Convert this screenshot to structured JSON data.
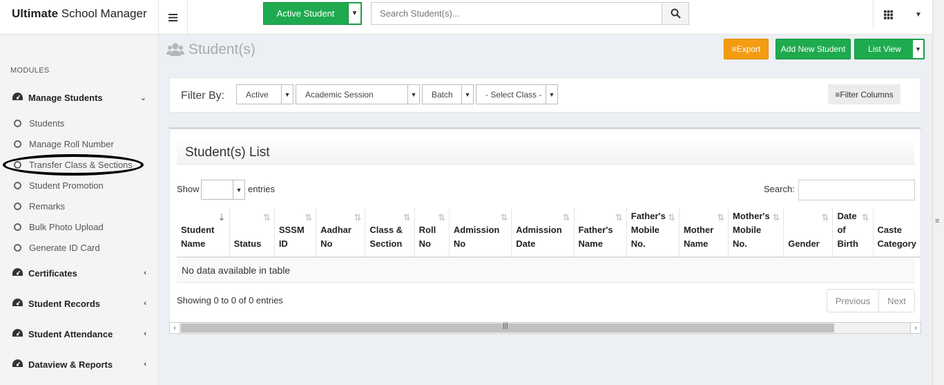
{
  "app": {
    "brand_bold": "Ultimate",
    "brand_rest": " School Manager"
  },
  "topbar": {
    "active_student_label": "Active Student",
    "search_placeholder": "Search Student(s)..."
  },
  "sidebar": {
    "modules_label": "MODULES",
    "sections": [
      {
        "label": "Manage Students",
        "expanded": true
      },
      {
        "label": "Certificates",
        "expanded": false
      },
      {
        "label": "Student Records",
        "expanded": false
      },
      {
        "label": "Student Attendance",
        "expanded": false
      },
      {
        "label": "Dataview & Reports",
        "expanded": false
      }
    ],
    "sub_items": [
      "Students",
      "Manage Roll Number",
      "Transfer Class & Sections",
      "Student Promotion",
      "Remarks",
      "Bulk Photo Upload",
      "Generate ID Card"
    ]
  },
  "page": {
    "title": "Student(s)",
    "export_label": "Export",
    "add_new_label": "Add New Student",
    "list_view_label": "List View"
  },
  "filter": {
    "label": "Filter By:",
    "status": "Active",
    "session": "Academic Session",
    "batch": "Batch",
    "class": "- Select Class -",
    "filter_columns_label": "Filter Columns"
  },
  "list": {
    "title": "Student(s) List",
    "show_label": "Show",
    "entries_label": "entries",
    "search_label": "Search:",
    "columns": [
      [
        "Student",
        "Name"
      ],
      [
        "Status"
      ],
      [
        "SSSM",
        "ID"
      ],
      [
        "Aadhar",
        "No"
      ],
      [
        "Class &",
        "Section"
      ],
      [
        "Roll",
        "No"
      ],
      [
        "Admission",
        "No"
      ],
      [
        "Admission",
        "Date"
      ],
      [
        "Father's",
        "Name"
      ],
      [
        "Father's",
        "Mobile",
        "No."
      ],
      [
        "Mother",
        "Name"
      ],
      [
        "Mother's",
        "Mobile",
        "No."
      ],
      [
        "Gender"
      ],
      [
        "Date",
        "of",
        "Birth"
      ],
      [
        "Caste",
        "Category"
      ]
    ],
    "no_data": "No data available in table",
    "info": "Showing 0 to 0 of 0 entries",
    "prev_label": "Previous",
    "next_label": "Next"
  }
}
